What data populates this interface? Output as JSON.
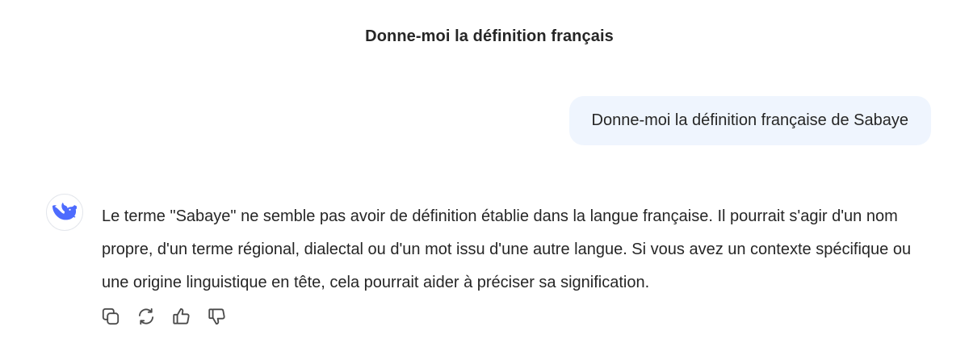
{
  "conversation": {
    "title": "Donne-moi la définition français"
  },
  "messages": {
    "user": {
      "text": "Donne-moi la définition française de Sabaye"
    },
    "assistant": {
      "avatar_icon": "deepseek-whale-icon",
      "text": "Le terme \"Sabaye\" ne semble pas avoir de définition établie dans la langue française. Il pourrait s'agir d'un nom propre, d'un terme régional, dialectal ou d'un mot issu d'une autre langue. Si vous avez un contexte spécifique ou une origine linguistique en tête, cela pourrait aider à préciser sa signification."
    }
  },
  "actions": [
    {
      "icon": "copy-icon"
    },
    {
      "icon": "regenerate-icon"
    },
    {
      "icon": "thumbs-up-icon"
    },
    {
      "icon": "thumbs-down-icon"
    }
  ],
  "colors": {
    "accent": "#4d6bfe",
    "user_bubble_bg": "#eff5fe",
    "text": "#262626",
    "icon": "#4b4b4b"
  }
}
